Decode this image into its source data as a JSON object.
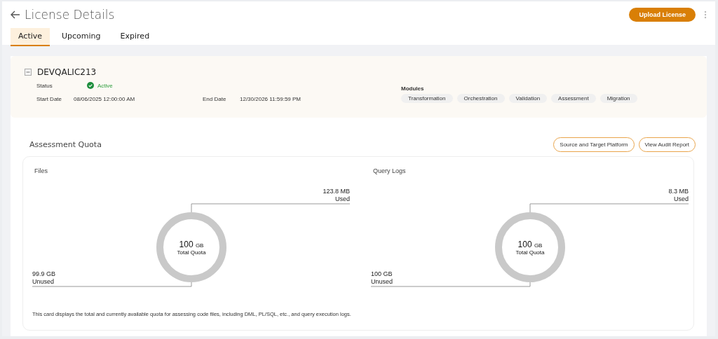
{
  "header": {
    "title": "License Details",
    "upload_button": "Upload License"
  },
  "tabs": [
    {
      "label": "Active",
      "selected": true
    },
    {
      "label": "Upcoming",
      "selected": false
    },
    {
      "label": "Expired",
      "selected": false
    }
  ],
  "license": {
    "name": "DEVQALIC213",
    "expanded": true,
    "status_label": "Status",
    "status": "Active",
    "start_label": "Start Date",
    "start": "08/06/2025 12:00:00 AM",
    "end_label": "End Date",
    "end": "12/30/2026 11:59:59 PM",
    "modules_label": "Modules",
    "modules": [
      "Transformation",
      "Orchestration",
      "Validation",
      "Assessment",
      "Migration"
    ]
  },
  "quota": {
    "title": "Assessment Quota",
    "buttons": [
      "Source and Target Platform",
      "View Audit Report"
    ],
    "panels": [
      {
        "title": "Files",
        "used": "123.8 MB",
        "used_label": "Used",
        "unused": "99.9 GB",
        "unused_label": "Unused",
        "total": "100",
        "total_unit": "GB",
        "total_label": "Total Quota"
      },
      {
        "title": "Query Logs",
        "used": "8.3 MB",
        "used_label": "Used",
        "unused": "100 GB",
        "unused_label": "Unused",
        "total": "100",
        "total_unit": "GB",
        "total_label": "Total Quota"
      }
    ],
    "note": "This card displays the total and currently available quota for assessing code files, including DML, PL/SQL, etc., and query execution logs."
  }
}
